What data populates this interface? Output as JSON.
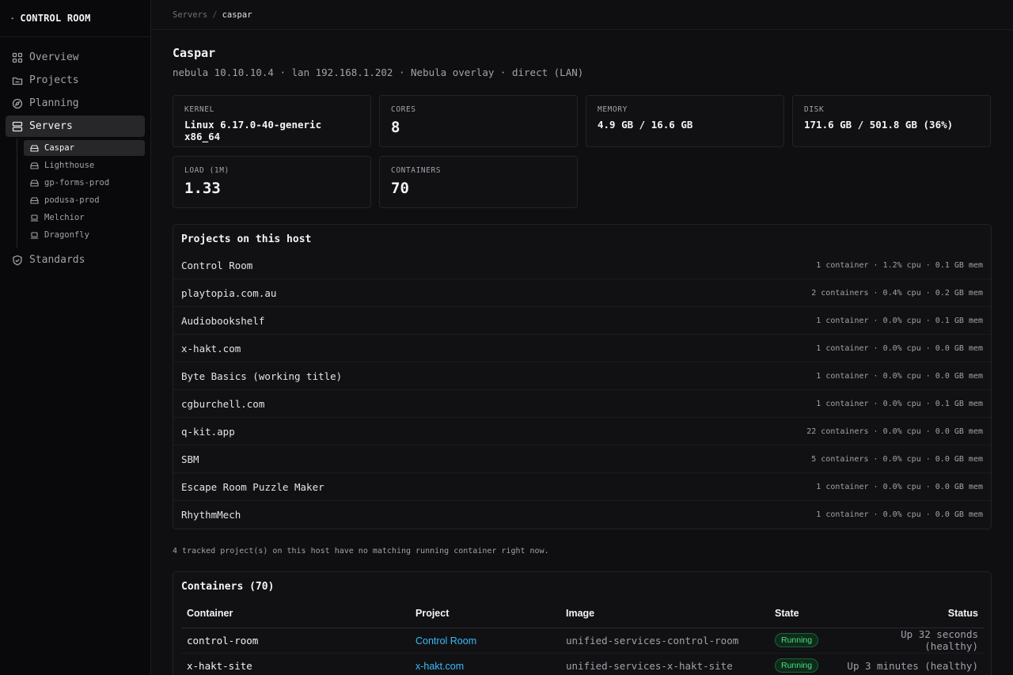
{
  "brand": {
    "caret": "▸",
    "title": "CONTROL ROOM"
  },
  "nav": [
    {
      "label": "Overview",
      "icon": "grid-icon"
    },
    {
      "label": "Projects",
      "icon": "folder-icon"
    },
    {
      "label": "Planning",
      "icon": "compass-icon"
    },
    {
      "label": "Servers",
      "icon": "server-icon",
      "active": true
    },
    {
      "label": "Standards",
      "icon": "shield-icon"
    }
  ],
  "servers": [
    {
      "label": "Caspar",
      "icon": "server-drive-icon",
      "active": true
    },
    {
      "label": "Lighthouse",
      "icon": "server-drive-icon"
    },
    {
      "label": "gp-forms-prod",
      "icon": "server-drive-icon"
    },
    {
      "label": "podusa-prod",
      "icon": "server-drive-icon"
    },
    {
      "label": "Melchior",
      "icon": "laptop-icon"
    },
    {
      "label": "Dragonfly",
      "icon": "laptop-icon"
    }
  ],
  "breadcrumb": {
    "parent": "Servers",
    "sep": "/",
    "current": "caspar"
  },
  "host": {
    "title": "Caspar",
    "subtitle": "nebula 10.10.10.4 · lan 192.168.1.202 · Nebula overlay · direct (LAN)"
  },
  "stats": {
    "kernel": {
      "label": "KERNEL",
      "value": "Linux 6.17.0-40-generic x86_64"
    },
    "cores": {
      "label": "CORES",
      "value": "8"
    },
    "memory": {
      "label": "MEMORY",
      "value": "4.9 GB / 16.6 GB"
    },
    "disk": {
      "label": "DISK",
      "value": "171.6 GB / 501.8 GB (36%)"
    },
    "load": {
      "label": "LOAD (1M)",
      "value": "1.33"
    },
    "containers": {
      "label": "CONTAINERS",
      "value": "70"
    }
  },
  "projects": {
    "title": "Projects on this host",
    "rows": [
      {
        "name": "Control Room",
        "meta": "1 container · 1.2% cpu · 0.1 GB mem"
      },
      {
        "name": "playtopia.com.au",
        "meta": "2 containers · 0.4% cpu · 0.2 GB mem"
      },
      {
        "name": "Audiobookshelf",
        "meta": "1 container · 0.0% cpu · 0.1 GB mem"
      },
      {
        "name": "x-hakt.com",
        "meta": "1 container · 0.0% cpu · 0.0 GB mem"
      },
      {
        "name": "Byte Basics (working title)",
        "meta": "1 container · 0.0% cpu · 0.0 GB mem"
      },
      {
        "name": "cgburchell.com",
        "meta": "1 container · 0.0% cpu · 0.1 GB mem"
      },
      {
        "name": "q-kit.app",
        "meta": "22 containers · 0.0% cpu · 0.0 GB mem"
      },
      {
        "name": "SBM",
        "meta": "5 containers · 0.0% cpu · 0.0 GB mem"
      },
      {
        "name": "Escape Room Puzzle Maker",
        "meta": "1 container · 0.0% cpu · 0.0 GB mem"
      },
      {
        "name": "RhythmMech",
        "meta": "1 container · 0.0% cpu · 0.0 GB mem"
      }
    ],
    "note": "4 tracked project(s) on this host have no matching running container right now."
  },
  "containers": {
    "title": "Containers (70)",
    "headers": {
      "container": "Container",
      "project": "Project",
      "image": "Image",
      "state": "State",
      "status": "Status"
    },
    "rows": [
      {
        "container": "control-room",
        "project": "Control Room",
        "image": "unified-services-control-room",
        "state": "Running",
        "status": "Up 32 seconds (healthy)"
      },
      {
        "container": "x-hakt-site",
        "project": "x-hakt.com",
        "image": "unified-services-x-hakt-site",
        "state": "Running",
        "status": "Up 3 minutes (healthy)"
      }
    ]
  },
  "colors": {
    "accent_link": "#38bdf8",
    "running": "#4ade80",
    "background": "#0f0f11"
  }
}
